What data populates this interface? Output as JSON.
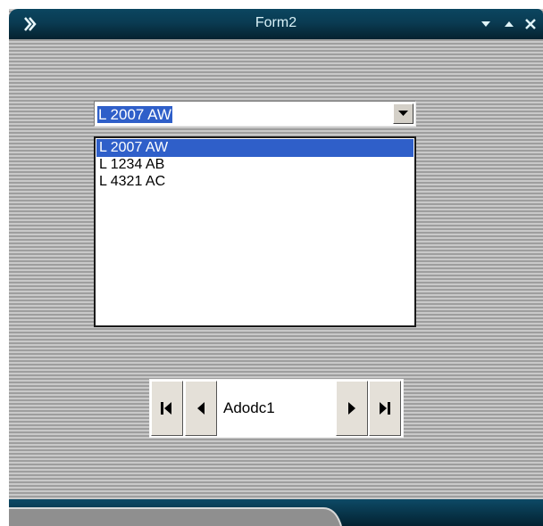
{
  "window": {
    "title": "Form2",
    "icons": {
      "app": "double-chevron-icon",
      "minimize": "minimize-icon",
      "maximize": "maximize-icon",
      "close": "close-icon"
    }
  },
  "combo": {
    "value": "L 2007 AW",
    "arrow_icon": "chevron-down-icon",
    "options": [
      "L 2007 AW",
      "L 1234 AB",
      "L 4321 AC"
    ],
    "selected_index": 0
  },
  "adodc": {
    "caption": "Adodc1",
    "buttons": {
      "first": "move-first-icon",
      "prev": "move-previous-icon",
      "next": "move-next-icon",
      "last": "move-last-icon"
    }
  },
  "colors": {
    "title_bar": "#0a3b52",
    "selection": "#2f5fc9",
    "stripe_light": "#c9c9c9",
    "stripe_dark": "#9e9e9e",
    "bottom_bar": "#073246"
  }
}
